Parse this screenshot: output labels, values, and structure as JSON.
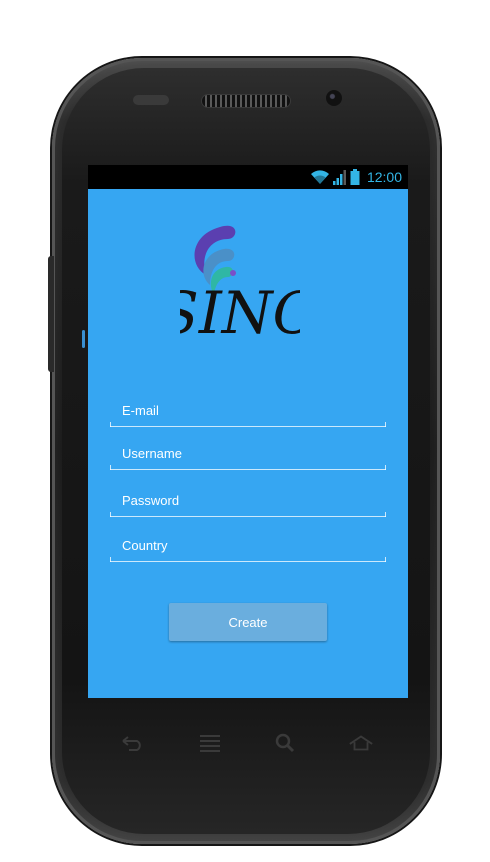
{
  "status_bar": {
    "time": "12:00",
    "icons": [
      "wifi-icon",
      "signal-icon",
      "battery-icon"
    ]
  },
  "logo": {
    "text": "SINC"
  },
  "form": {
    "email": {
      "placeholder": "E-mail",
      "value": ""
    },
    "username": {
      "placeholder": "Username",
      "value": ""
    },
    "password": {
      "placeholder": "Password",
      "value": ""
    },
    "country": {
      "placeholder": "Country",
      "value": ""
    }
  },
  "create_button": {
    "label": "Create"
  },
  "hardware_keys": [
    "back-icon",
    "menu-icon",
    "search-icon",
    "home-icon"
  ],
  "colors": {
    "screen_bg": "#36a6f2",
    "button_bg": "#6aaede",
    "status_bar_bg": "#000000",
    "clock": "#33b5e5"
  }
}
